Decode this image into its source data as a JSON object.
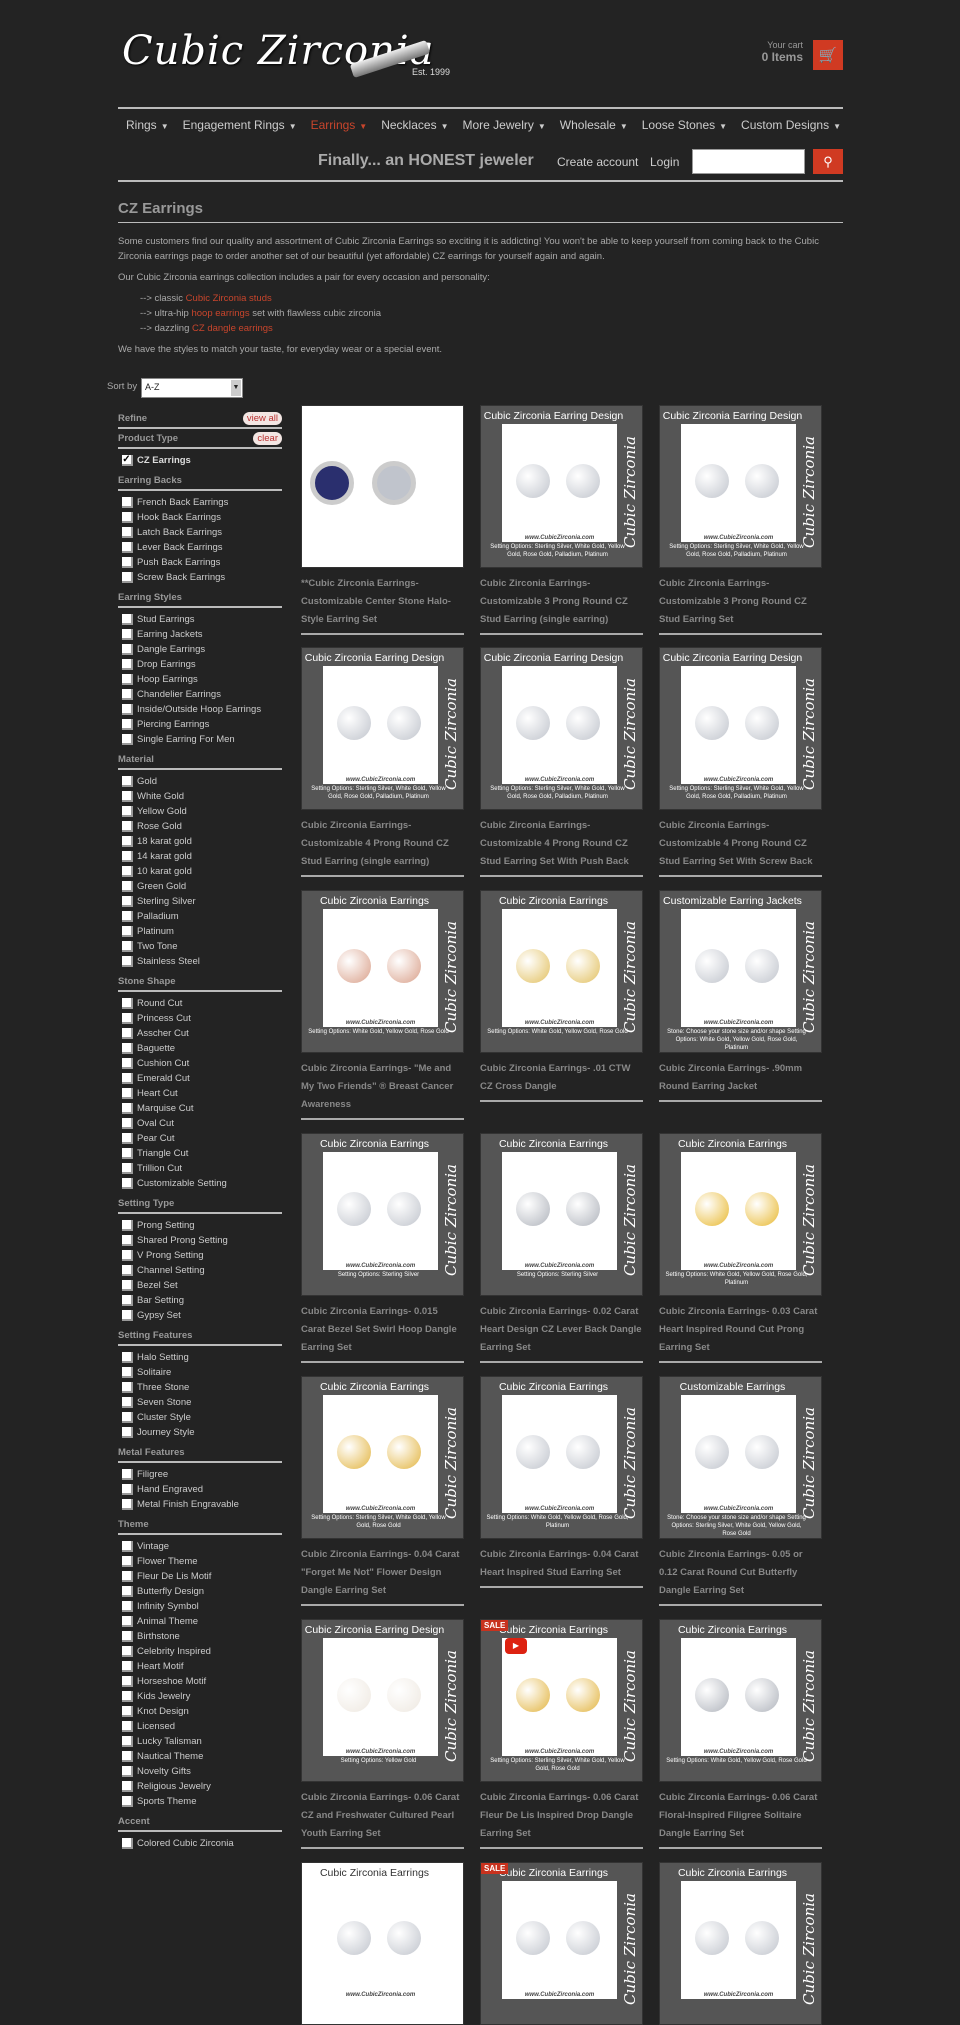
{
  "header": {
    "logo_text": "Cubic Zirconia",
    "logo_est": "Est. 1999",
    "cart_label": "Your cart",
    "cart_items": "0 Items",
    "cart_icon": "cart-icon",
    "accent": "#d03a22"
  },
  "nav": [
    {
      "label": "Rings"
    },
    {
      "label": "Engagement Rings"
    },
    {
      "label": "Earrings",
      "active": true
    },
    {
      "label": "Necklaces"
    },
    {
      "label": "More Jewelry"
    },
    {
      "label": "Wholesale"
    },
    {
      "label": "Loose Stones"
    },
    {
      "label": "Custom Designs"
    }
  ],
  "subheader": {
    "tagline": "Finally... an HONEST jeweler",
    "create_account": "Create account",
    "login": "Login",
    "search_value": "",
    "search_icon": "search-icon"
  },
  "page": {
    "title": "CZ Earrings",
    "p1": "Some customers find our quality and assortment of Cubic Zirconia Earrings so exciting it is addicting!  You won't be able to keep yourself from coming back to the Cubic Zirconia earrings page to order another set of our beautiful (yet affordable) CZ earrings for yourself again and again.",
    "p2": "Our Cubic Zirconia earrings collection includes a pair for every occasion and personality:",
    "list": [
      {
        "pre": "--> classic ",
        "link": "Cubic Zirconia studs",
        "post": ""
      },
      {
        "pre": "--> ultra-hip ",
        "link": "hoop earrings",
        "post": " set with flawless cubic zirconia"
      },
      {
        "pre": "--> dazzling ",
        "link": "CZ dangle earrings",
        "post": ""
      }
    ],
    "p3": "We have the styles to match your taste, for everyday wear or a special event."
  },
  "sort": {
    "label": "Sort by",
    "value": "A-Z"
  },
  "sidebar": {
    "refine": "Refine",
    "view_all": "view all",
    "groups": [
      {
        "title": "Product Type",
        "action": "clear",
        "options": [
          {
            "label": "CZ Earrings",
            "checked": true
          }
        ]
      },
      {
        "title": "Earring Backs",
        "options": [
          {
            "label": "French Back Earrings"
          },
          {
            "label": "Hook Back Earrings"
          },
          {
            "label": "Latch Back Earrings"
          },
          {
            "label": "Lever Back Earrings"
          },
          {
            "label": "Push Back Earrings"
          },
          {
            "label": "Screw Back Earrings"
          }
        ]
      },
      {
        "title": "Earring Styles",
        "options": [
          {
            "label": "Stud Earrings"
          },
          {
            "label": "Earring Jackets"
          },
          {
            "label": "Dangle Earrings"
          },
          {
            "label": "Drop Earrings"
          },
          {
            "label": "Hoop Earrings"
          },
          {
            "label": "Chandelier Earrings"
          },
          {
            "label": "Inside/Outside Hoop Earrings"
          },
          {
            "label": "Piercing Earrings"
          },
          {
            "label": "Single Earring For Men"
          }
        ]
      },
      {
        "title": "Material",
        "options": [
          {
            "label": "Gold"
          },
          {
            "label": "White Gold"
          },
          {
            "label": "Yellow Gold"
          },
          {
            "label": "Rose Gold"
          },
          {
            "label": "18 karat gold"
          },
          {
            "label": "14 karat gold"
          },
          {
            "label": "10 karat gold"
          },
          {
            "label": "Green Gold"
          },
          {
            "label": "Sterling Silver"
          },
          {
            "label": "Palladium"
          },
          {
            "label": "Platinum"
          },
          {
            "label": "Two Tone"
          },
          {
            "label": "Stainless Steel"
          }
        ]
      },
      {
        "title": "Stone Shape",
        "options": [
          {
            "label": "Round Cut"
          },
          {
            "label": "Princess Cut"
          },
          {
            "label": "Asscher Cut"
          },
          {
            "label": "Baguette"
          },
          {
            "label": "Cushion Cut"
          },
          {
            "label": "Emerald Cut"
          },
          {
            "label": "Heart Cut"
          },
          {
            "label": "Marquise Cut"
          },
          {
            "label": "Oval Cut"
          },
          {
            "label": "Pear Cut"
          },
          {
            "label": "Triangle Cut"
          },
          {
            "label": "Trillion Cut"
          },
          {
            "label": "Customizable Setting"
          }
        ]
      },
      {
        "title": "Setting Type",
        "options": [
          {
            "label": "Prong Setting"
          },
          {
            "label": "Shared Prong Setting"
          },
          {
            "label": "V Prong Setting"
          },
          {
            "label": "Channel Setting"
          },
          {
            "label": "Bezel Set"
          },
          {
            "label": "Bar Setting"
          },
          {
            "label": "Gypsy Set"
          }
        ]
      },
      {
        "title": "Setting Features",
        "options": [
          {
            "label": "Halo Setting"
          },
          {
            "label": "Solitaire"
          },
          {
            "label": "Three Stone"
          },
          {
            "label": "Seven Stone"
          },
          {
            "label": "Cluster Style"
          },
          {
            "label": "Journey Style"
          }
        ]
      },
      {
        "title": "Metal Features",
        "options": [
          {
            "label": "Filigree"
          },
          {
            "label": "Hand Engraved"
          },
          {
            "label": "Metal Finish Engravable"
          }
        ]
      },
      {
        "title": "Theme",
        "options": [
          {
            "label": "Vintage"
          },
          {
            "label": "Flower Theme"
          },
          {
            "label": "Fleur De Lis Motif"
          },
          {
            "label": "Butterfly Design"
          },
          {
            "label": "Infinity Symbol"
          },
          {
            "label": "Animal Theme"
          },
          {
            "label": "Birthstone"
          },
          {
            "label": "Celebrity Inspired"
          },
          {
            "label": "Heart Motif"
          },
          {
            "label": "Horseshoe Motif"
          },
          {
            "label": "Kids Jewelry"
          },
          {
            "label": "Knot Design"
          },
          {
            "label": "Licensed"
          },
          {
            "label": "Lucky Talisman"
          },
          {
            "label": "Nautical Theme"
          },
          {
            "label": "Novelty Gifts"
          },
          {
            "label": "Religious Jewelry"
          },
          {
            "label": "Sports Theme"
          }
        ]
      },
      {
        "title": "Accent",
        "options": [
          {
            "label": "Colored Cubic Zirconia"
          }
        ]
      }
    ]
  },
  "image_lettering": {
    "url": "www.CubicZirconia.com",
    "side": "Cubic Zirconia"
  },
  "products": [
    {
      "title": "**Cubic Zirconia Earrings- Customizable Center Stone Halo-Style Earring Set",
      "plain": true,
      "metal": "#c0c4cc"
    },
    {
      "title": "Cubic Zirconia Earrings- Customizable 3 Prong Round CZ Stud Earring (single earring)",
      "badge": "Cubic Zirconia Earring Design",
      "options": "Setting Options: Sterling Silver, White Gold, Yellow Gold, Rose Gold, Palladium, Platinum",
      "metal": "#c0c4cc"
    },
    {
      "title": "Cubic Zirconia Earrings- Customizable 3 Prong Round CZ Stud Earring Set",
      "badge": "Cubic Zirconia Earring Design",
      "options": "Setting Options: Sterling Silver, White Gold, Yellow Gold, Rose Gold, Palladium, Platinum",
      "metal": "#c0c4cc"
    },
    {
      "title": "Cubic Zirconia Earrings- Customizable 4 Prong Round CZ Stud Earring (single earring)",
      "badge": "Cubic Zirconia Earring Design",
      "options": "Setting Options: Sterling Silver, White Gold, Yellow Gold, Rose Gold, Palladium, Platinum",
      "metal": "#c0c4cc"
    },
    {
      "title": "Cubic Zirconia Earrings- Customizable 4 Prong Round CZ Stud Earring Set With Push Back",
      "badge": "Cubic Zirconia Earring Design",
      "options": "Setting Options: Sterling Silver, White Gold, Yellow Gold, Rose Gold, Palladium, Platinum",
      "metal": "#c0c4cc"
    },
    {
      "title": "Cubic Zirconia Earrings- Customizable 4 Prong Round CZ Stud Earring Set With Screw Back",
      "badge": "Cubic Zirconia Earring Design",
      "options": "Setting Options: Sterling Silver, White Gold, Yellow Gold, Rose Gold, Palladium, Platinum",
      "metal": "#c0c4cc"
    },
    {
      "title": "Cubic Zirconia Earrings- \"Me and My Two Friends\" ® Breast Cancer Awareness",
      "badge": "Cubic Zirconia Earrings",
      "options": "Setting Options: White Gold, Yellow Gold, Rose Gold",
      "metal": "#d9a08a"
    },
    {
      "title": "Cubic Zirconia Earrings- .01 CTW CZ Cross Dangle",
      "badge": "Cubic Zirconia Earrings",
      "options": "Setting Options: White Gold, Yellow Gold, Rose Gold",
      "metal": "#e2c060"
    },
    {
      "title": "Cubic Zirconia Earrings- .90mm Round Earring Jacket",
      "badge": "Customizable Earring Jackets",
      "options": "Stone: Choose your stone size and/or shape Setting Options: White Gold, Yellow Gold, Rose Gold, Platinum",
      "metal": "#c0c4cc"
    },
    {
      "title": "Cubic Zirconia Earrings- 0.015 Carat Bezel Set Swirl Hoop Dangle Earring Set",
      "badge": "Cubic Zirconia Earrings",
      "options": "Setting Options: Sterling Silver",
      "metal": "#c0c4cc"
    },
    {
      "title": "Cubic Zirconia Earrings- 0.02 Carat Heart Design CZ Lever Back Dangle Earring Set",
      "badge": "Cubic Zirconia Earrings",
      "options": "Setting Options: Sterling Silver",
      "metal": "#b0b4bc"
    },
    {
      "title": "Cubic Zirconia Earrings- 0.03 Carat Heart Inspired Round Cut Prong Earring Set",
      "badge": "Cubic Zirconia Earrings",
      "options": "Setting Options: White Gold, Yellow Gold, Rose Gold, Platinum",
      "metal": "#e8b830"
    },
    {
      "title": "Cubic Zirconia Earrings- 0.04 Carat \"Forget Me Not\" Flower Design Dangle Earring Set",
      "badge": "Cubic Zirconia Earrings",
      "options": "Setting Options: Sterling Silver, White Gold, Yellow Gold, Rose Gold",
      "metal": "#e2b440"
    },
    {
      "title": "Cubic Zirconia Earrings- 0.04 Carat Heart Inspired Stud Earring Set",
      "badge": "Cubic Zirconia Earrings",
      "options": "Setting Options: White Gold, Yellow Gold, Rose Gold, Platinum",
      "metal": "#c0c4cc"
    },
    {
      "title": "Cubic Zirconia Earrings- 0.05 or 0.12 Carat Round Cut Butterfly Dangle Earring Set",
      "badge": "Customizable Earrings",
      "options": "Stone: Choose your stone size and/or shape Setting Options: Sterling Silver, White Gold, Yellow Gold, Rose Gold",
      "metal": "#c0c4cc"
    },
    {
      "title": "Cubic Zirconia Earrings- 0.06 Carat CZ and Freshwater Cultured Pearl Youth Earring Set",
      "badge": "Cubic Zirconia Earring Design",
      "options": "Setting Options: Yellow Gold",
      "metal": "#eee8e0"
    },
    {
      "title": "Cubic Zirconia Earrings- 0.06 Carat Fleur De Lis Inspired Drop Dangle Earring Set",
      "badge": "Cubic Zirconia Earrings",
      "options": "Setting Options: Sterling Silver, White Gold, Yellow Gold, Rose Gold",
      "sale": "SALE",
      "video": true,
      "metal": "#e2b440"
    },
    {
      "title": "Cubic Zirconia Earrings- 0.06 Carat Floral-Inspired Filigree Solitaire Dangle Earring Set",
      "badge": "Cubic Zirconia Earrings",
      "options": "Setting Options: White Gold, Yellow Gold, Rose Gold",
      "metal": "#b0b4bc"
    },
    {
      "title": "",
      "badge": "Cubic Zirconia Earrings",
      "white": true,
      "metal": "#c0c4cc"
    },
    {
      "title": "",
      "badge": "Cubic Zirconia Earrings",
      "sale": "SALE",
      "metal": "#c0c4cc"
    },
    {
      "title": "",
      "badge": "Cubic Zirconia Earrings",
      "metal": "#c0c4cc"
    }
  ]
}
